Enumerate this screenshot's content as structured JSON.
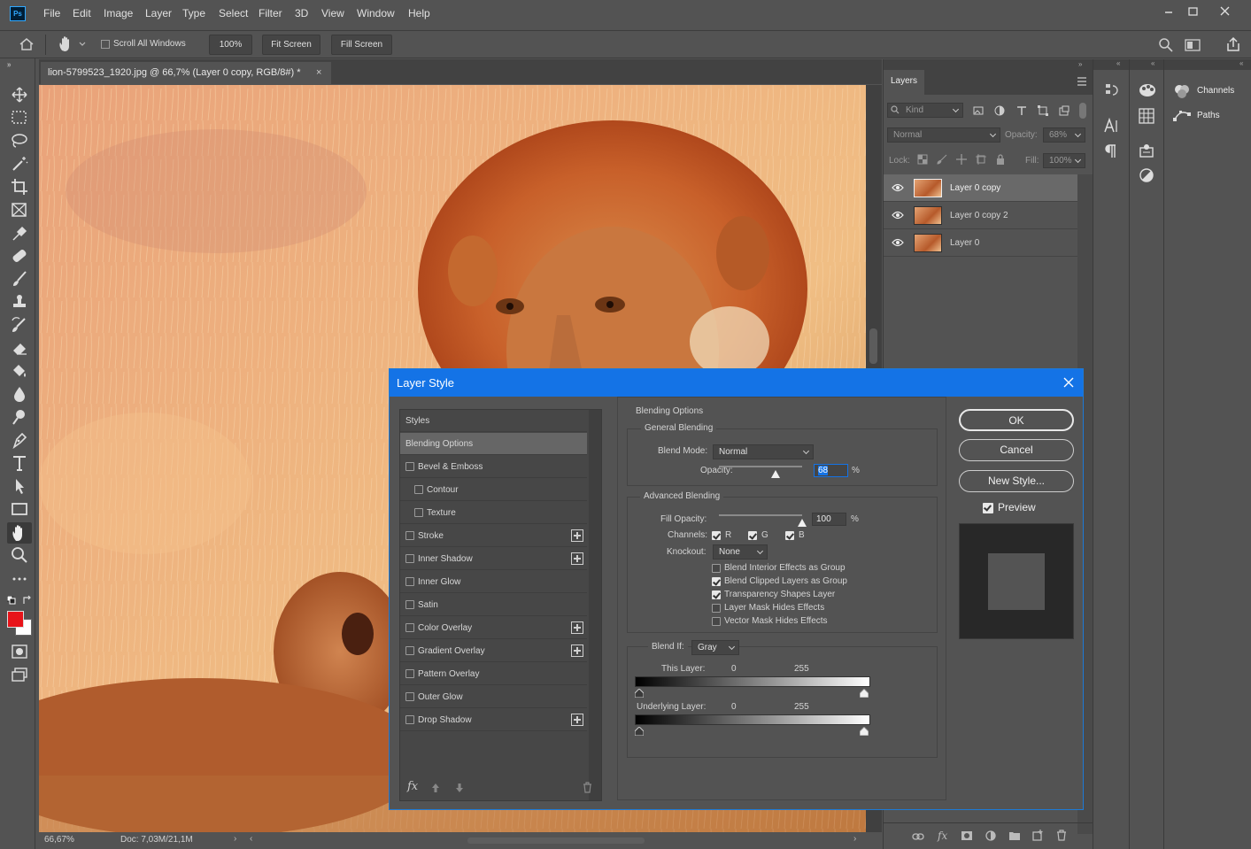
{
  "app": {
    "logo": "Ps",
    "menu": [
      "File",
      "Edit",
      "Image",
      "Layer",
      "Type",
      "Select",
      "Filter",
      "3D",
      "View",
      "Window",
      "Help"
    ],
    "window_controls": [
      "minimize-icon",
      "restore-icon",
      "close-icon"
    ]
  },
  "options_bar": {
    "scroll_all_windows": "Scroll All Windows",
    "zoom_100": "100%",
    "fit_screen": "Fit Screen",
    "fill_screen": "Fill Screen"
  },
  "document": {
    "tab_title": "lion-5799523_1920.jpg @ 66,7% (Layer 0 copy, RGB/8#) *",
    "zoom": "66,67%",
    "doc_info": "Doc: 7,03M/21,1M"
  },
  "tools": [
    "move-icon",
    "marquee-icon",
    "lasso-icon",
    "magic-wand-icon",
    "crop-icon",
    "frame-icon",
    "eyedropper-icon",
    "healing-icon",
    "brush-icon",
    "stamp-icon",
    "history-brush-icon",
    "eraser-icon",
    "bucket-icon",
    "blur-icon",
    "dodge-icon",
    "pen-icon",
    "type-icon",
    "path-select-icon",
    "rectangle-icon",
    "hand-icon",
    "zoom-icon",
    "more-icon"
  ],
  "colors": {
    "foreground": "#e8141a",
    "background": "#ffffff",
    "accent": "#1473e6"
  },
  "layers_panel": {
    "tab": "Layers",
    "filter_kind": "Kind",
    "blend_mode": "Normal",
    "opacity_label": "Opacity:",
    "opacity_value": "68%",
    "lock_label": "Lock:",
    "fill_label": "Fill:",
    "fill_value": "100%",
    "layers": [
      {
        "name": "Layer 0 copy",
        "selected": true
      },
      {
        "name": "Layer 0 copy 2",
        "selected": false
      },
      {
        "name": "Layer 0",
        "selected": false
      }
    ]
  },
  "side_panels": {
    "channels": "Channels",
    "paths": "Paths"
  },
  "dialog": {
    "title": "Layer Style",
    "style_list": [
      {
        "label": "Styles",
        "checkbox": false,
        "indent": false,
        "plus": false,
        "selected": false
      },
      {
        "label": "Blending Options",
        "checkbox": false,
        "indent": false,
        "plus": false,
        "selected": true
      },
      {
        "label": "Bevel & Emboss",
        "checkbox": true,
        "indent": false,
        "plus": false,
        "selected": false
      },
      {
        "label": "Contour",
        "checkbox": true,
        "indent": true,
        "plus": false,
        "selected": false
      },
      {
        "label": "Texture",
        "checkbox": true,
        "indent": true,
        "plus": false,
        "selected": false
      },
      {
        "label": "Stroke",
        "checkbox": true,
        "indent": false,
        "plus": true,
        "selected": false
      },
      {
        "label": "Inner Shadow",
        "checkbox": true,
        "indent": false,
        "plus": true,
        "selected": false
      },
      {
        "label": "Inner Glow",
        "checkbox": true,
        "indent": false,
        "plus": false,
        "selected": false
      },
      {
        "label": "Satin",
        "checkbox": true,
        "indent": false,
        "plus": false,
        "selected": false
      },
      {
        "label": "Color Overlay",
        "checkbox": true,
        "indent": false,
        "plus": true,
        "selected": false
      },
      {
        "label": "Gradient Overlay",
        "checkbox": true,
        "indent": false,
        "plus": true,
        "selected": false
      },
      {
        "label": "Pattern Overlay",
        "checkbox": true,
        "indent": false,
        "plus": false,
        "selected": false
      },
      {
        "label": "Outer Glow",
        "checkbox": true,
        "indent": false,
        "plus": false,
        "selected": false
      },
      {
        "label": "Drop Shadow",
        "checkbox": true,
        "indent": false,
        "plus": true,
        "selected": false
      }
    ],
    "fx_label": "fx",
    "blending_options": "Blending Options",
    "general_blending": "General Blending",
    "blend_mode_label": "Blend Mode:",
    "blend_mode_value": "Normal",
    "opacity_label": "Opacity:",
    "opacity_value": "68",
    "opacity_fraction": 0.68,
    "percent": "%",
    "advanced_blending": "Advanced Blending",
    "fill_opacity_label": "Fill Opacity:",
    "fill_opacity_value": "100",
    "fill_opacity_fraction": 1.0,
    "channels_label": "Channels:",
    "channel_r": "R",
    "channel_g": "G",
    "channel_b": "B",
    "knockout_label": "Knockout:",
    "knockout_value": "None",
    "adv_options": [
      {
        "label": "Blend Interior Effects as Group",
        "checked": false
      },
      {
        "label": "Blend Clipped Layers as Group",
        "checked": true
      },
      {
        "label": "Transparency Shapes Layer",
        "checked": true
      },
      {
        "label": "Layer Mask Hides Effects",
        "checked": false
      },
      {
        "label": "Vector Mask Hides Effects",
        "checked": false
      }
    ],
    "blend_if_label": "Blend If:",
    "blend_if_value": "Gray",
    "this_layer_label": "This Layer:",
    "underlying_label": "Underlying Layer:",
    "range_min": "0",
    "range_max": "255",
    "ok": "OK",
    "cancel": "Cancel",
    "new_style": "New Style...",
    "preview": "Preview"
  }
}
